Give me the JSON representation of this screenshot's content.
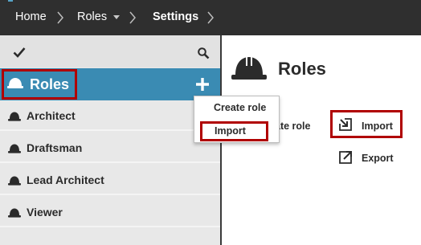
{
  "breadcrumb": {
    "items": [
      {
        "label": "Home"
      },
      {
        "label": "Roles"
      },
      {
        "label": "Settings"
      }
    ]
  },
  "sidebar": {
    "header_label": "Roles",
    "items": [
      {
        "label": "Architect"
      },
      {
        "label": "Draftsman"
      },
      {
        "label": "Lead Architect"
      },
      {
        "label": "Viewer"
      }
    ]
  },
  "dropdown": {
    "items": [
      {
        "label": "Create role"
      },
      {
        "label": "Import"
      }
    ]
  },
  "main": {
    "title": "Roles",
    "partial_action_label": "ate role",
    "actions": [
      {
        "label": "Import",
        "icon": "import-icon"
      },
      {
        "label": "Export",
        "icon": "export-icon"
      }
    ]
  },
  "colors": {
    "topbar": "#2f2f2f",
    "accent_blue": "#3a8bb3",
    "highlight_red": "#b00000",
    "sidebar_bg": "#e8e8e8"
  },
  "icons": {
    "check": "check-icon",
    "search": "search-icon",
    "add": "plus-icon",
    "role": "hard-hat-icon"
  }
}
